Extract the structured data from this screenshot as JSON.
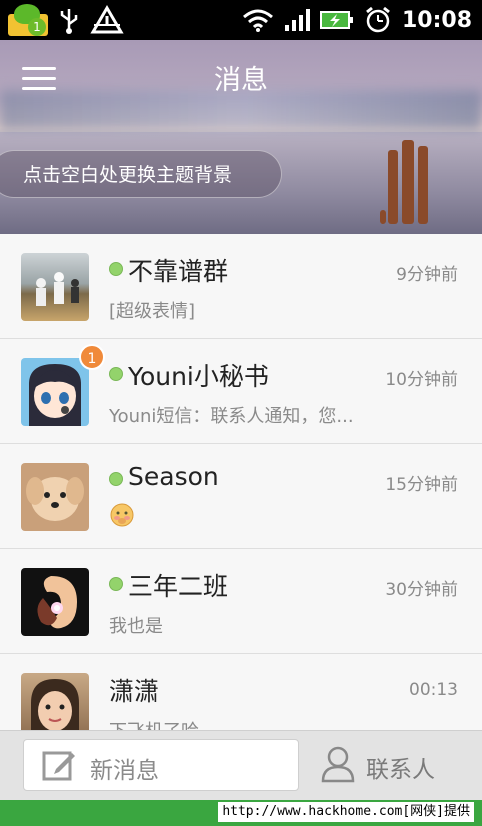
{
  "status_bar": {
    "notification_badge": "1",
    "time": "10:08",
    "icons": [
      "qq-notification-icon",
      "usb-icon",
      "warning-icon",
      "wifi-icon",
      "signal-icon",
      "battery-charging-icon",
      "alarm-icon"
    ]
  },
  "header": {
    "title": "消息",
    "theme_button": "点击空白处更换主题背景"
  },
  "conversations": [
    {
      "name": "不靠谱群",
      "time": "9分钟前",
      "preview": "[超级表情]",
      "online": true,
      "unread": ""
    },
    {
      "name": "Youni小秘书",
      "time": "10分钟前",
      "preview": "Youni短信：联系人通知，您...",
      "online": true,
      "unread": "1"
    },
    {
      "name": "Season",
      "time": "15分钟前",
      "preview": "",
      "online": true,
      "unread": ""
    },
    {
      "name": "三年二班",
      "time": "30分钟前",
      "preview": "我也是",
      "online": true,
      "unread": ""
    },
    {
      "name": "潇潇",
      "time": "00:13",
      "preview": "下飞机了哈",
      "online": false,
      "unread": ""
    }
  ],
  "bottom_bar": {
    "new_message": "新消息",
    "contacts": "联系人"
  },
  "footer": {
    "text": "http://www.hackhome.com[网侠]提供"
  },
  "colors": {
    "online": "#93d36b",
    "unread_badge": "#f08a3a",
    "footer": "#3aa640"
  }
}
